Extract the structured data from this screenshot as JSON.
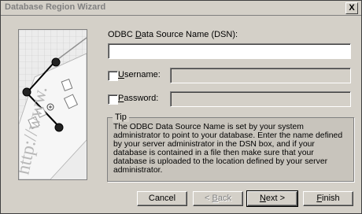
{
  "window": {
    "title": "Database Region Wizard",
    "close_label": "X"
  },
  "illustration": {
    "watermark_text": "http://www."
  },
  "form": {
    "dsn_label_pre": "ODBC ",
    "dsn_label_ul": "D",
    "dsn_label_post": "ata Source Name (DSN):",
    "dsn_value": "",
    "username_label_ul": "U",
    "username_label_post": "sername:",
    "username_value": "",
    "password_label_ul": "P",
    "password_label_post": "assword:",
    "password_value": ""
  },
  "tip": {
    "title": "Tip",
    "text": "The ODBC Data Source Name is set by your system administrator to point to your database.  Enter the name defined by your server administrator in the DSN box, and if your database is contained in a file then make sure that your database is uploaded to the location defined by your server administrator."
  },
  "buttons": {
    "cancel": "Cancel",
    "back_pre": "< ",
    "back_ul": "B",
    "back_post": "ack",
    "next_ul": "N",
    "next_post": "ext >",
    "finish_ul": "F",
    "finish_post": "inish"
  }
}
